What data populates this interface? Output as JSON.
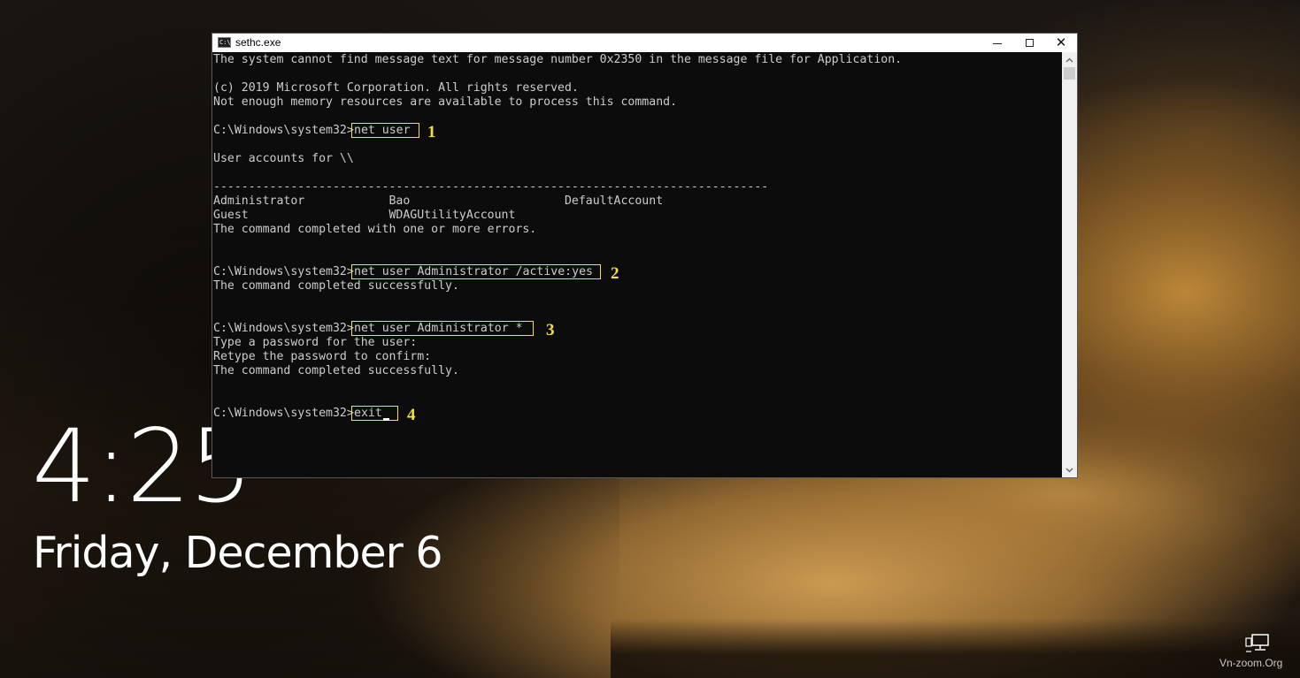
{
  "window": {
    "title": "sethc.exe",
    "icon": "cmd-icon",
    "icon_text": "C:\\",
    "controls": {
      "minimize": "minimize-icon",
      "maximize": "maximize-icon",
      "close": "close-icon",
      "close_glyph": "✕"
    }
  },
  "console": {
    "lines": [
      "The system cannot find message text for message number 0x2350 in the message file for Application.",
      "(c) 2019 Microsoft Corporation. All rights reserved.",
      "Not enough memory resources are available to process this command.",
      "User accounts for \\\\",
      "-------------------------------------------------------------------------------",
      "Administrator            Bao                      DefaultAccount",
      "Guest                    WDAGUtilityAccount",
      "The command completed with one or more errors.",
      "The command completed successfully.",
      "Type a password for the user:",
      "Retype the password to confirm:",
      "The command completed successfully."
    ],
    "prompt": "C:\\Windows\\system32>",
    "commands": [
      {
        "text": "net user ",
        "step": "1"
      },
      {
        "text": "net user Administrator /active:yes ",
        "step": "2"
      },
      {
        "text": "net user Administrator * ",
        "step": "3"
      },
      {
        "text": "exit",
        "step": "4"
      }
    ]
  },
  "lockscreen": {
    "time": "4:25",
    "date": "Friday, December 6",
    "network_icon": "network-icon"
  },
  "watermark": "Vn-zoom.Org",
  "colors": {
    "console_bg": "#0c0c0c",
    "console_text": "#cccccc",
    "highlight": "#f5e13a"
  }
}
